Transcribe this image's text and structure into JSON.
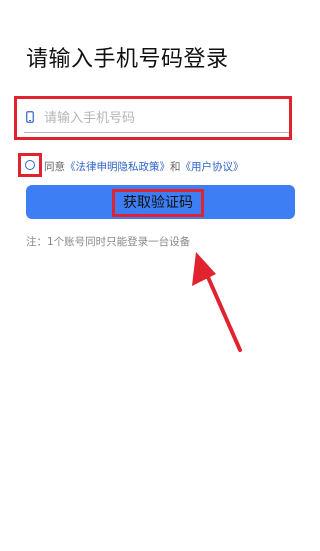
{
  "page": {
    "title": "请输入手机号码登录"
  },
  "phone": {
    "placeholder": "请输入手机号码",
    "value": "",
    "icon": "phone-icon"
  },
  "agreement": {
    "prefix": "同意",
    "privacy_link": "《法律申明隐私政策》",
    "conjunction": "和",
    "user_link": "《用户协议》",
    "checked": false
  },
  "get_code_button": {
    "label": "获取验证码",
    "color": "#3d7ef5"
  },
  "note": {
    "text": "注：1个账号同时只能登录一台设备"
  },
  "colors": {
    "accent": "#3d7ef5",
    "link": "#2f64c8",
    "annotation": "#e0232f"
  }
}
